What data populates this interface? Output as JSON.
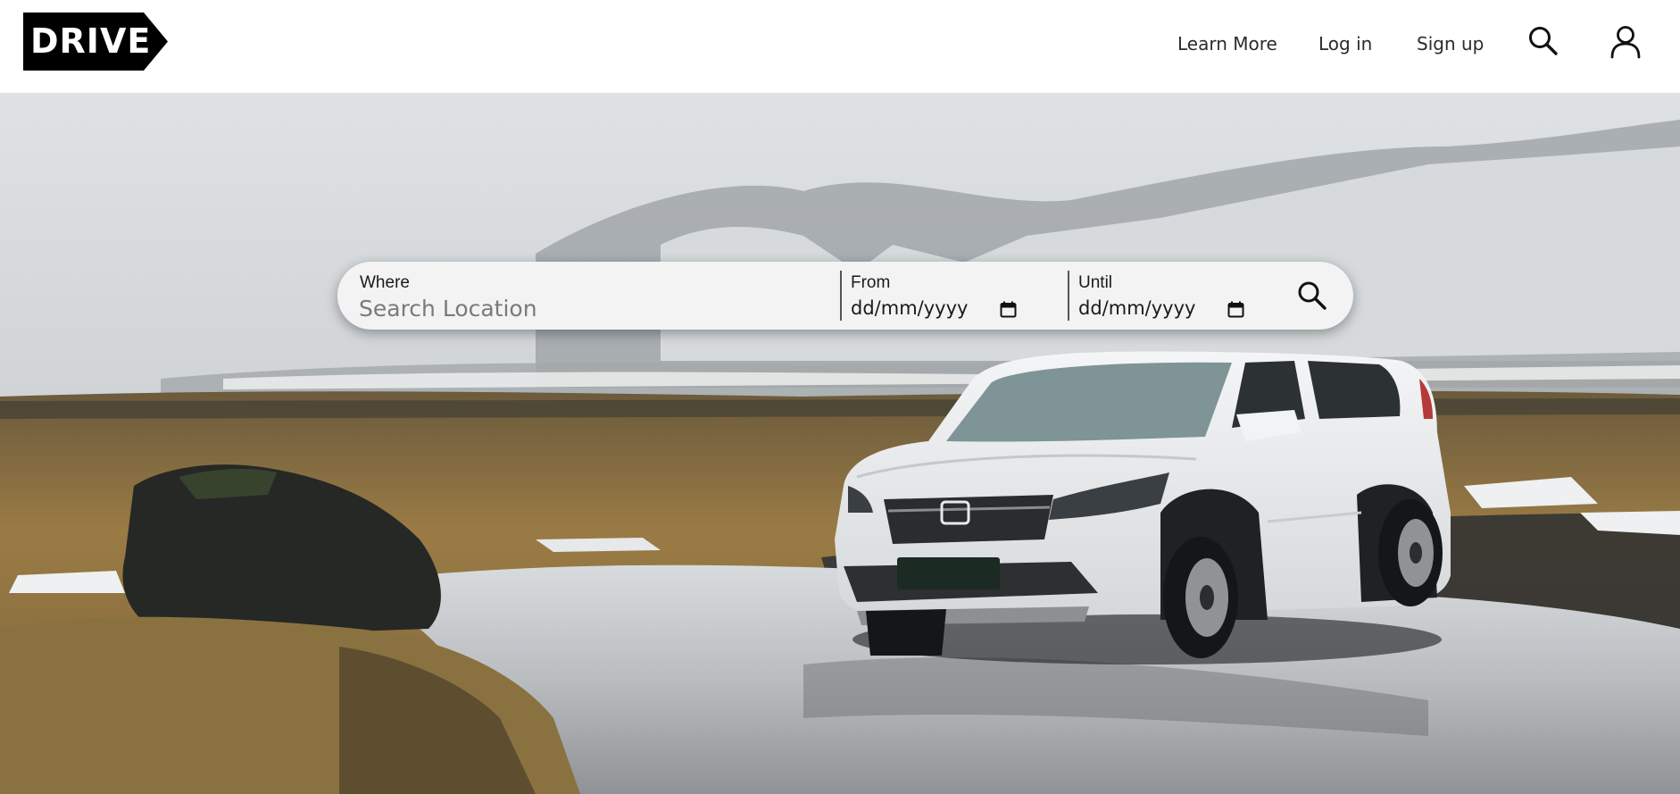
{
  "header": {
    "logo_text": "DRIVE",
    "nav": {
      "learn_more": "Learn More",
      "log_in": "Log in",
      "sign_up": "Sign up"
    },
    "icons": [
      "search-icon",
      "user-icon"
    ]
  },
  "search": {
    "where_label": "Where",
    "where_placeholder": "Search Location",
    "where_value": "",
    "from_label": "From",
    "from_value": "dd/mm/yyyy",
    "until_label": "Until",
    "until_value": "dd/mm/yyyy",
    "icons": [
      "calendar-icon",
      "search-icon"
    ]
  },
  "hero": {
    "image": "white SUV parked on icy ground near a rock with snowy mountains and fog"
  },
  "colors": {
    "logo_bg": "#000000",
    "logo_text": "#ffffff",
    "nav_text": "#2b2b2b",
    "searchbar_bg": "#f3f3f3"
  }
}
